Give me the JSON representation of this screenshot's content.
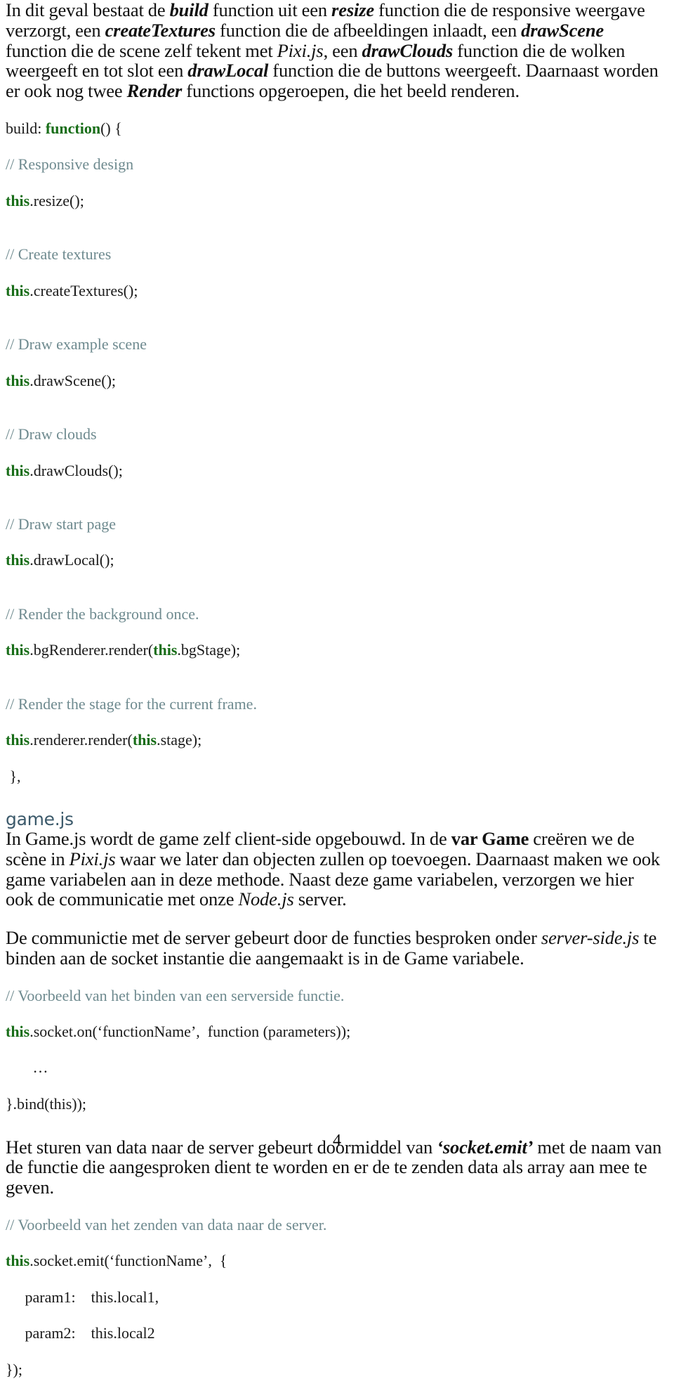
{
  "page": {
    "number": "4"
  },
  "paragraphs": {
    "intro": {
      "segments": [
        {
          "text": "In dit geval bestaat de ",
          "style": "normal"
        },
        {
          "text": "build",
          "style": "bold-italic"
        },
        {
          "text": " function uit een ",
          "style": "normal"
        },
        {
          "text": "resize",
          "style": "bold-italic"
        },
        {
          "text": " function die de responsive weergave verzorgt, een ",
          "style": "normal"
        },
        {
          "text": "createTextures",
          "style": "bold-italic"
        },
        {
          "text": " function die de afbeeldingen inlaadt, een ",
          "style": "normal"
        },
        {
          "text": "drawScene",
          "style": "bold-italic"
        },
        {
          "text": " function die de scene zelf tekent met ",
          "style": "normal"
        },
        {
          "text": "Pixi.js",
          "style": "italic"
        },
        {
          "text": ", een ",
          "style": "normal"
        },
        {
          "text": "drawClouds",
          "style": "bold-italic"
        },
        {
          "text": " function die de wolken weergeeft en tot slot een ",
          "style": "normal"
        },
        {
          "text": "drawLocal",
          "style": "bold-italic"
        },
        {
          "text": " function die de buttons weergeeft. Daarnaast worden er ook nog twee ",
          "style": "normal"
        },
        {
          "text": "Render",
          "style": "bold-italic"
        },
        {
          "text": " functions opgeroepen, die het beeld renderen.",
          "style": "normal"
        }
      ],
      "plain": "In dit geval bestaat de build function uit een resize function die de responsive weergave verzorgt, een createTextures function die de afbeeldingen inlaadt, een drawScene function die de scene zelf tekent met Pixi.js, een drawClouds function die de wolken weergeeft en tot slot een drawLocal function die de buttons weergeeft. Daarnaast worden er ook nog twee Render functions opgeroepen, die het beeld renderen."
    },
    "gamejs_body": {
      "segments": [
        {
          "text": "In Game.js wordt de game zelf client-side opgebouwd. In de ",
          "style": "normal"
        },
        {
          "text": "var Game",
          "style": "bold"
        },
        {
          "text": " creëren we de scène  in ",
          "style": "normal"
        },
        {
          "text": "Pixi.js",
          "style": "italic"
        },
        {
          "text": " waar we later dan objecten zullen op toevoegen. Daarnaast maken we ook game variabelen aan in deze methode. Naast deze game variabelen, verzorgen we hier ook de communicatie met onze ",
          "style": "normal"
        },
        {
          "text": "Node.js",
          "style": "italic"
        },
        {
          "text": " server.",
          "style": "normal"
        }
      ],
      "plain": "In Game.js wordt de game zelf client-side opgebouwd. In de var Game creëren we de scène  in Pixi.js waar we later dan objecten zullen op toevoegen. Daarnaast maken we ook game variabelen aan in deze methode. Naast deze game variabelen, verzorgen we hier ook de communicatie met onze Node.js server."
    },
    "communication": {
      "segments": [
        {
          "text": "De communictie met de server gebeurt door de functies besproken onder ",
          "style": "normal"
        },
        {
          "text": "server-side.js",
          "style": "italic"
        },
        {
          "text": " te binden aan de socket instantie die aangemaakt is in de Game variabele.",
          "style": "normal"
        }
      ],
      "plain": "De communictie met de server gebeurt door de functies besproken onder server-side.js te binden aan de socket instantie die aangemaakt is in de Game variabele."
    },
    "emit": {
      "segments": [
        {
          "text": "Het sturen van data naar de server gebeurt doormiddel van ",
          "style": "normal"
        },
        {
          "text": "‘socket.emit’",
          "style": "bold-italic"
        },
        {
          "text": "  met de naam van de functie die aangesproken dient te worden en er de te zenden data als array aan mee te geven.",
          "style": "normal"
        }
      ],
      "plain": "Het sturen van data naar de server gebeurt doormiddel van ‘socket.emit’  met de naam van de functie die aangesproken dient te worden en er de te zenden data als array aan mee te geven."
    }
  },
  "headings": {
    "gamejs": "game.js"
  },
  "code_blocks": {
    "build": {
      "lines": [
        [
          {
            "t": "build: ",
            "c": "plain"
          },
          {
            "t": "function",
            "c": "keyword"
          },
          {
            "t": "() {",
            "c": "plain"
          }
        ],
        [
          {
            "t": "// Responsive design",
            "c": "comment"
          }
        ],
        [
          {
            "t": "this",
            "c": "keyword"
          },
          {
            "t": ".resize();",
            "c": "plain"
          }
        ],
        [
          {
            "t": "",
            "c": "blank"
          }
        ],
        [
          {
            "t": "// Create textures",
            "c": "comment"
          }
        ],
        [
          {
            "t": "this",
            "c": "keyword"
          },
          {
            "t": ".createTextures();",
            "c": "plain"
          }
        ],
        [
          {
            "t": "",
            "c": "blank"
          }
        ],
        [
          {
            "t": "// Draw example scene",
            "c": "comment"
          }
        ],
        [
          {
            "t": "this",
            "c": "keyword"
          },
          {
            "t": ".drawScene();",
            "c": "plain"
          }
        ],
        [
          {
            "t": "",
            "c": "blank"
          }
        ],
        [
          {
            "t": "// Draw clouds",
            "c": "comment"
          }
        ],
        [
          {
            "t": "this",
            "c": "keyword"
          },
          {
            "t": ".drawClouds();",
            "c": "plain"
          }
        ],
        [
          {
            "t": "",
            "c": "blank"
          }
        ],
        [
          {
            "t": "// Draw start page",
            "c": "comment"
          }
        ],
        [
          {
            "t": "this",
            "c": "keyword"
          },
          {
            "t": ".drawLocal();",
            "c": "plain"
          }
        ],
        [
          {
            "t": "",
            "c": "blank"
          }
        ],
        [
          {
            "t": "// Render the background once.",
            "c": "comment"
          }
        ],
        [
          {
            "t": "this",
            "c": "keyword"
          },
          {
            "t": ".bgRenderer.render(",
            "c": "plain"
          },
          {
            "t": "this",
            "c": "keyword"
          },
          {
            "t": ".bgStage);",
            "c": "plain"
          }
        ],
        [
          {
            "t": "",
            "c": "blank"
          }
        ],
        [
          {
            "t": "// Render the stage for the current frame.",
            "c": "comment"
          }
        ],
        [
          {
            "t": "this",
            "c": "keyword"
          },
          {
            "t": ".renderer.render(",
            "c": "plain"
          },
          {
            "t": "this",
            "c": "keyword"
          },
          {
            "t": ".stage);",
            "c": "plain"
          }
        ],
        [
          {
            "t": " },",
            "c": "plain"
          }
        ]
      ]
    },
    "socket_on": {
      "lines": [
        [
          {
            "t": "// Voorbeeld van het binden van een serverside functie.",
            "c": "comment"
          }
        ],
        [
          {
            "t": "this",
            "c": "keyword"
          },
          {
            "t": ".socket.on(‘functionName’,  function (parameters));",
            "c": "plain"
          }
        ],
        [
          {
            "t": "       …",
            "c": "plain"
          }
        ],
        [
          {
            "t": "}.bind(this));",
            "c": "plain"
          }
        ]
      ]
    },
    "socket_emit": {
      "lines": [
        [
          {
            "t": "// Voorbeeld van het zenden van data naar de server.",
            "c": "comment"
          }
        ],
        [
          {
            "t": "this",
            "c": "keyword"
          },
          {
            "t": ".socket.emit(‘functionName’,  {",
            "c": "plain"
          }
        ],
        [
          {
            "t": "     param1:    this.local1,",
            "c": "plain"
          }
        ],
        [
          {
            "t": "     param2:    this.local2",
            "c": "plain"
          }
        ],
        [
          {
            "t": "});",
            "c": "plain"
          }
        ]
      ]
    }
  },
  "colors": {
    "keyword": "#186d18",
    "comment": "#6e8a8f",
    "heading": "#3c5a6b",
    "body": "#111111",
    "background": "#ffffff"
  }
}
